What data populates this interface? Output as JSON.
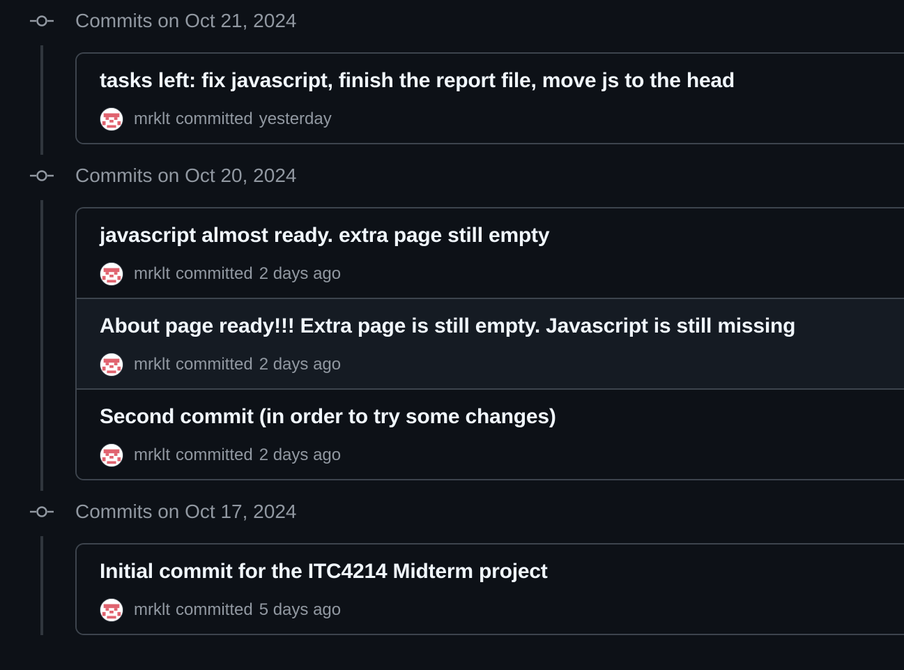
{
  "commit_groups": [
    {
      "date_label": "Commits on Oct 21, 2024",
      "commits": [
        {
          "message": "tasks left: fix javascript, finish the report file, move js to the head",
          "author": "mrklt",
          "action": "committed",
          "time": "yesterday"
        }
      ]
    },
    {
      "date_label": "Commits on Oct 20, 2024",
      "commits": [
        {
          "message": "javascript almost ready. extra page still empty",
          "author": "mrklt",
          "action": "committed",
          "time": "2 days ago"
        },
        {
          "message": "About page ready!!! Extra page is still empty. Javascript is still missing",
          "author": "mrklt",
          "action": "committed",
          "time": "2 days ago",
          "hovered": true
        },
        {
          "message": "Second commit (in order to try some changes)",
          "author": "mrklt",
          "action": "committed",
          "time": "2 days ago"
        }
      ]
    },
    {
      "date_label": "Commits on Oct 17, 2024",
      "commits": [
        {
          "message": "Initial commit for the ITC4214 Midterm project",
          "author": "mrklt",
          "action": "committed",
          "time": "5 days ago"
        }
      ]
    }
  ],
  "colors": {
    "background": "#0d1117",
    "border": "#3d444d",
    "timeline": "#30363d",
    "muted_text": "#9198a1",
    "title_text": "#f0f6fc",
    "hover_row": "#151b23",
    "avatar_accent": "#e0636f"
  },
  "icons": {
    "group_marker": "git-commit-icon",
    "avatar": "identicon-avatar"
  }
}
